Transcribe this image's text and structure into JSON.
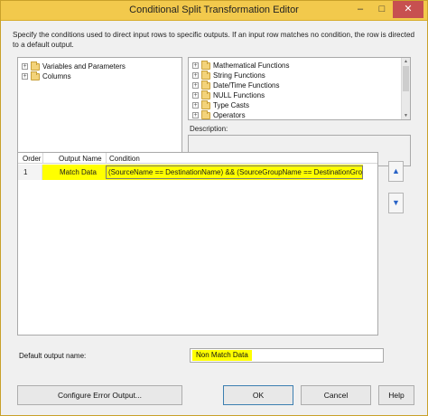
{
  "window": {
    "title": "Conditional Split Transformation Editor",
    "controls": {
      "minimize": "–",
      "maximize": "□",
      "close": "✕"
    }
  },
  "description": "Specify the conditions used to direct input rows to specific outputs. If an input row matches no condition, the row is directed to a default output.",
  "left_tree": {
    "items": [
      {
        "label": "Variables and Parameters",
        "icon": "folder-icon"
      },
      {
        "label": "Columns",
        "icon": "folder-icon"
      }
    ]
  },
  "right_tree": {
    "items": [
      {
        "label": "Mathematical Functions",
        "icon": "folder-icon"
      },
      {
        "label": "String Functions",
        "icon": "folder-icon"
      },
      {
        "label": "Date/Time Functions",
        "icon": "folder-icon"
      },
      {
        "label": "NULL Functions",
        "icon": "folder-icon"
      },
      {
        "label": "Type Casts",
        "icon": "folder-icon"
      },
      {
        "label": "Operators",
        "icon": "folder-icon"
      }
    ]
  },
  "description_panel": {
    "label": "Description:",
    "value": ""
  },
  "grid": {
    "columns": [
      "Order",
      "Output Name",
      "Condition"
    ],
    "rows": [
      {
        "order": "1",
        "output_name": "Match Data",
        "condition": "(SourceName == DestinationName) && (SourceGroupName == DestinationGrou..."
      }
    ]
  },
  "move_up": {
    "icon": "arrow-up-icon",
    "glyph": "▲"
  },
  "move_down": {
    "icon": "arrow-down-icon",
    "glyph": "▼"
  },
  "default_output": {
    "label": "Default output name:",
    "value": "Non Match Data"
  },
  "buttons": {
    "configure": "Configure Error Output...",
    "ok": "OK",
    "cancel": "Cancel",
    "help": "Help"
  },
  "colors": {
    "highlight": "#ffff00",
    "titlebar": "#f2c94c",
    "accent": "#2a64c7"
  }
}
